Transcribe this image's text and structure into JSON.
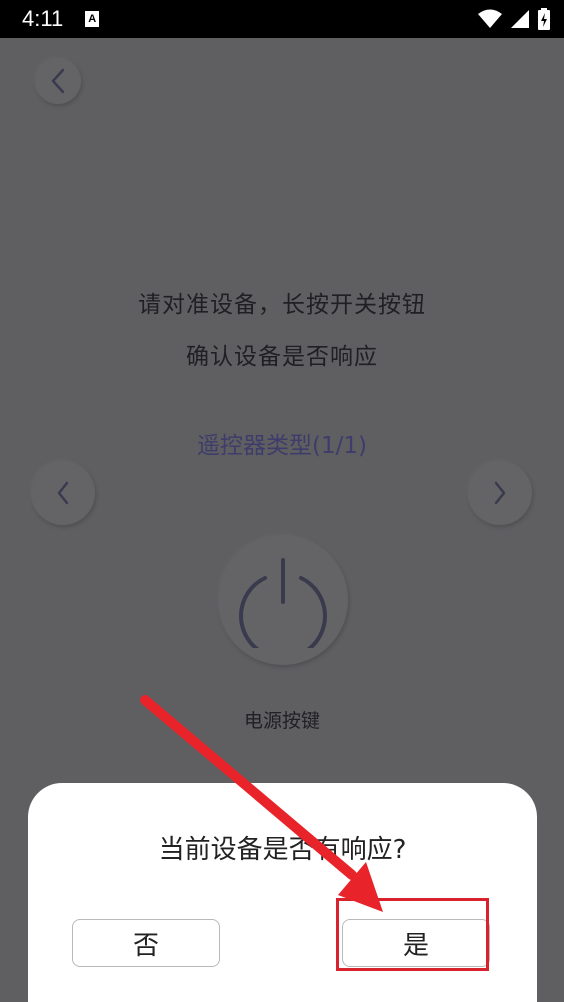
{
  "status_bar": {
    "time": "4:11",
    "notification_icon": "A",
    "icons": [
      "wifi-icon",
      "signal-icon",
      "battery-icon"
    ]
  },
  "screen": {
    "back_icon": "chevron-left-icon",
    "instruction_line1": "请对准设备，长按开关按钮",
    "instruction_line2": "确认设备是否响应",
    "remote_type": "遥控器类型(1/1)",
    "prev_icon": "chevron-left-icon",
    "next_icon": "chevron-right-icon",
    "power_icon": "power-icon",
    "power_label": "电源按键"
  },
  "dialog": {
    "question": "当前设备是否有响应?",
    "no_label": "否",
    "yes_label": "是"
  },
  "annotation": {
    "color": "#d8232e"
  },
  "colors": {
    "overlay_bg": "#5f5f62",
    "accent_text": "#3e3c6a",
    "dialog_bg": "#ffffff"
  }
}
